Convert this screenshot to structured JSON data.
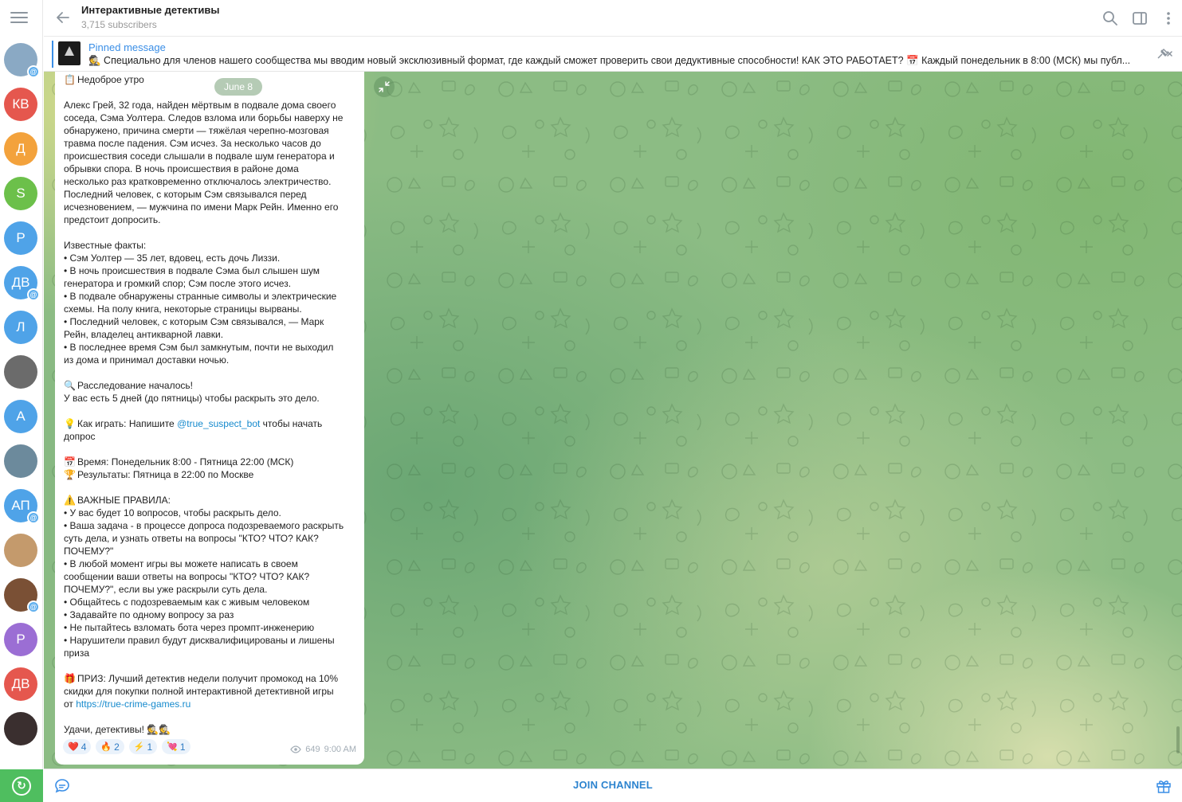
{
  "header": {
    "title": "Интерактивные детективы",
    "subtitle": "3,715 subscribers"
  },
  "pinned": {
    "label": "Pinned message",
    "text": "🕵️ Специально для членов нашего сообщества мы вводим новый эксклюзивный формат, где каждый сможет проверить свои дедуктивные способности!  КАК ЭТО РАБОТАЕТ? 📅 Каждый понедельник в 8:00 (МСК) мы публ..."
  },
  "chat_list": [
    {
      "initials": "",
      "color": "#8aa9c4",
      "mention": true
    },
    {
      "initials": "КВ",
      "color": "#e5574e",
      "mention": false
    },
    {
      "initials": "Д",
      "color": "#f3a23c",
      "mention": false
    },
    {
      "initials": "S",
      "color": "#6cc04a",
      "mention": false
    },
    {
      "initials": "Р",
      "color": "#4fa3e8",
      "mention": false
    },
    {
      "initials": "ДВ",
      "color": "#4fa3e8",
      "mention": true
    },
    {
      "initials": "Л",
      "color": "#4fa3e8",
      "mention": false
    },
    {
      "initials": "",
      "color": "#6b6b6b",
      "mention": false
    },
    {
      "initials": "А",
      "color": "#4fa3e8",
      "mention": false
    },
    {
      "initials": "",
      "color": "#6c8a9c",
      "mention": false
    },
    {
      "initials": "АП",
      "color": "#4fa3e8",
      "mention": true
    },
    {
      "initials": "",
      "color": "#c49a6c",
      "mention": false
    },
    {
      "initials": "",
      "color": "#7a5035",
      "mention": true
    },
    {
      "initials": "Р",
      "color": "#9b6ed4",
      "mention": false
    },
    {
      "initials": "ДВ",
      "color": "#e5574e",
      "mention": false
    },
    {
      "initials": "",
      "color": "#3a2f2f",
      "mention": false
    }
  ],
  "date_chip": "June 8",
  "message": {
    "lines": [
      {
        "emoji": "📋",
        "text": "Недоброе утро"
      },
      {
        "text": ""
      },
      {
        "text": "Алекс Грей, 32 года, найден мёртвым в подвале дома своего"
      },
      {
        "text": "соседа, Сэма Уолтера. Следов взлома или борьбы наверху не"
      },
      {
        "text": "обнаружено, причина смерти — тяжёлая черепно-мозговая"
      },
      {
        "text": "травма после падения. Сэм исчез. За несколько часов до"
      },
      {
        "text": "происшествия соседи слышали в подвале шум генератора и"
      },
      {
        "text": "обрывки спора. В ночь происшествия в районе дома"
      },
      {
        "text": "несколько раз кратковременно отключалось электричество."
      },
      {
        "text": "Последний человек, с которым Сэм связывался перед"
      },
      {
        "text": "исчезновением, — мужчина по имени Марк Рейн. Именно его"
      },
      {
        "text": "предстоит допросить."
      },
      {
        "text": ""
      },
      {
        "text": "Известные факты:"
      },
      {
        "text": "• Сэм Уолтер — 35 лет, вдовец, есть дочь Лиззи."
      },
      {
        "text": "• В ночь происшествия в подвале Сэма был слышен шум"
      },
      {
        "text": "генератора и громкий спор; Сэм после этого исчез."
      },
      {
        "text": "• В подвале обнаружены странные символы и электрические"
      },
      {
        "text": "схемы. На полу книга, некоторые страницы вырваны."
      },
      {
        "text": "• Последний человек, с которым Сэм связывался, — Марк"
      },
      {
        "text": "Рейн, владелец антикварной лавки."
      },
      {
        "text": "• В последнее время Сэм был замкнутым, почти не выходил"
      },
      {
        "text": "из дома и принимал доставки ночью."
      },
      {
        "text": ""
      },
      {
        "emoji": "🔍",
        "text": "Расследование началось!"
      },
      {
        "text": "У вас есть 5 дней (до пятницы) чтобы раскрыть это дело."
      },
      {
        "text": ""
      },
      {
        "emoji": "💡",
        "text": "Как играть: Напишите ",
        "link": "@true_suspect_bot",
        "after": " чтобы начать"
      },
      {
        "text": "допрос"
      },
      {
        "text": ""
      },
      {
        "emoji": "📅",
        "text": "Время: Понедельник 8:00 - Пятница 22:00 (МСК)"
      },
      {
        "emoji": "🏆",
        "text": "Результаты: Пятница в 22:00 по Москве"
      },
      {
        "text": ""
      },
      {
        "emoji": "⚠️",
        "text": "ВАЖНЫЕ ПРАВИЛА:"
      },
      {
        "text": "• У вас будет 10 вопросов, чтобы раскрыть дело."
      },
      {
        "text": "• Ваша задача - в процессе допроса подозреваемого раскрыть"
      },
      {
        "text": "суть дела, и узнать ответы на вопросы \"КТО? ЧТО? КАК?"
      },
      {
        "text": "ПОЧЕМУ?\""
      },
      {
        "text": "• В любой момент игры вы можете написать в своем"
      },
      {
        "text": "сообщении ваши ответы на вопросы \"КТО? ЧТО? КАК?"
      },
      {
        "text": "ПОЧЕМУ?\", если вы уже раскрыли суть дела."
      },
      {
        "text": "• Общайтесь с подозреваемым как с живым человеком"
      },
      {
        "text": "• Задавайте по одному вопросу за раз"
      },
      {
        "text": "• Не пытайтесь взломать бота через промпт-инженерию"
      },
      {
        "text": "• Нарушители правил будут дисквалифицированы и лишены"
      },
      {
        "text": "приза"
      },
      {
        "text": ""
      },
      {
        "emoji": "🎁",
        "text": "ПРИЗ: Лучший детектив недели получит промокод на 10%"
      },
      {
        "text": "скидки для покупки полной интерактивной детективной игры"
      },
      {
        "text": "от ",
        "link": "https://true-crime-games.ru",
        "after": ""
      },
      {
        "text": ""
      },
      {
        "text": "Удачи, детективы! 🕵️🕵️"
      }
    ],
    "reactions": [
      {
        "icon": "❤️",
        "count": "4"
      },
      {
        "icon": "🔥",
        "count": "2"
      },
      {
        "icon": "⚡",
        "count": "1"
      },
      {
        "icon": "💘",
        "count": "1"
      }
    ],
    "views": "649",
    "time": "9:00 AM"
  },
  "bottom_bar": {
    "join_label": "JOIN CHANNEL"
  },
  "colors": {
    "accent": "#3a8ee6",
    "join": "#2d84cf",
    "update": "#4fbe5f"
  }
}
